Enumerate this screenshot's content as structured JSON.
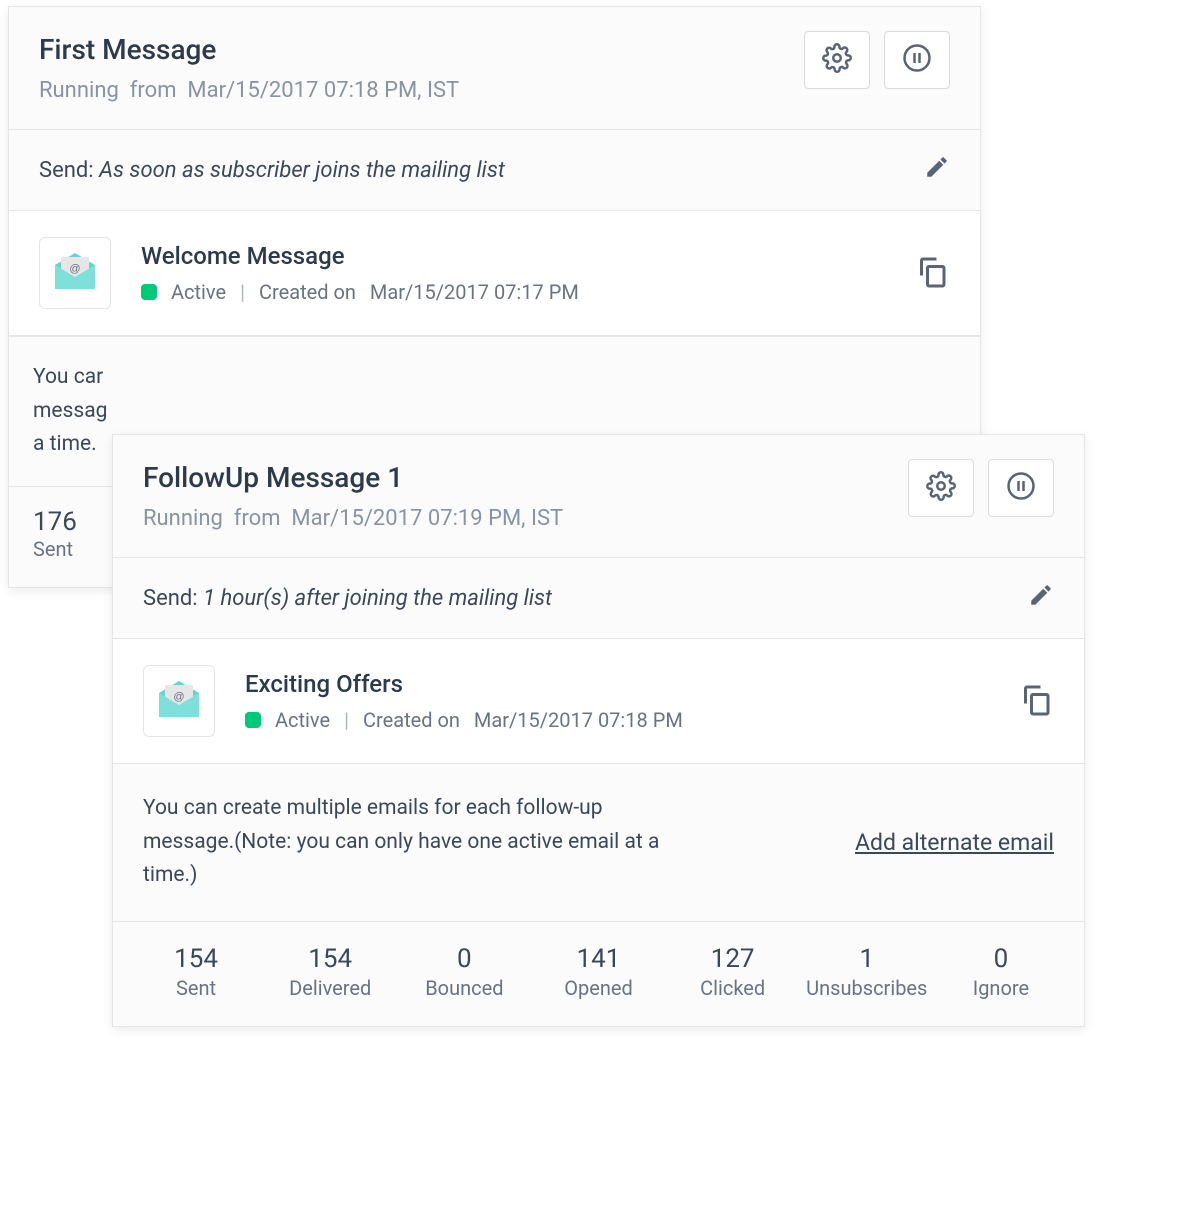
{
  "cards": [
    {
      "title": "First Message",
      "status_word": "Running",
      "from_word": "from",
      "running_from": "Mar/15/2017 07:18 PM, IST",
      "send_label": "Send:",
      "send_condition": "As soon as subscriber  joins the mailing list",
      "message": {
        "name": "Welcome Message",
        "status": "Active",
        "created_label": "Created on",
        "created_at": "Mar/15/2017 07:17 PM"
      },
      "peek_note_lines": [
        "You car",
        "messag",
        "a time."
      ],
      "peek_stat": {
        "num": "176",
        "label": "Sent"
      }
    },
    {
      "title": "FollowUp Message 1",
      "status_word": "Running",
      "from_word": "from",
      "running_from": "Mar/15/2017 07:19 PM, IST",
      "send_label": "Send:",
      "send_condition": "1  hour(s) after  joining the mailing list",
      "message": {
        "name": "Exciting Offers",
        "status": "Active",
        "created_label": "Created on",
        "created_at": "Mar/15/2017 07:18 PM"
      },
      "note": "You can create multiple emails for each follow-up message.(Note: you can only have one active email at a time.)",
      "add_alternate_label": "Add alternate email",
      "stats": [
        {
          "value": "154",
          "label": "Sent"
        },
        {
          "value": "154",
          "label": "Delivered"
        },
        {
          "value": "0",
          "label": "Bounced"
        },
        {
          "value": "141",
          "label": "Opened"
        },
        {
          "value": "127",
          "label": "Clicked"
        },
        {
          "value": "1",
          "label": "Unsubscribes"
        },
        {
          "value": "0",
          "label": "Ignore"
        }
      ]
    }
  ],
  "icons": {
    "gear": "gear-icon",
    "pause": "pause-icon",
    "edit": "edit-icon",
    "copy": "copy-icon",
    "mail": "mail-icon"
  }
}
